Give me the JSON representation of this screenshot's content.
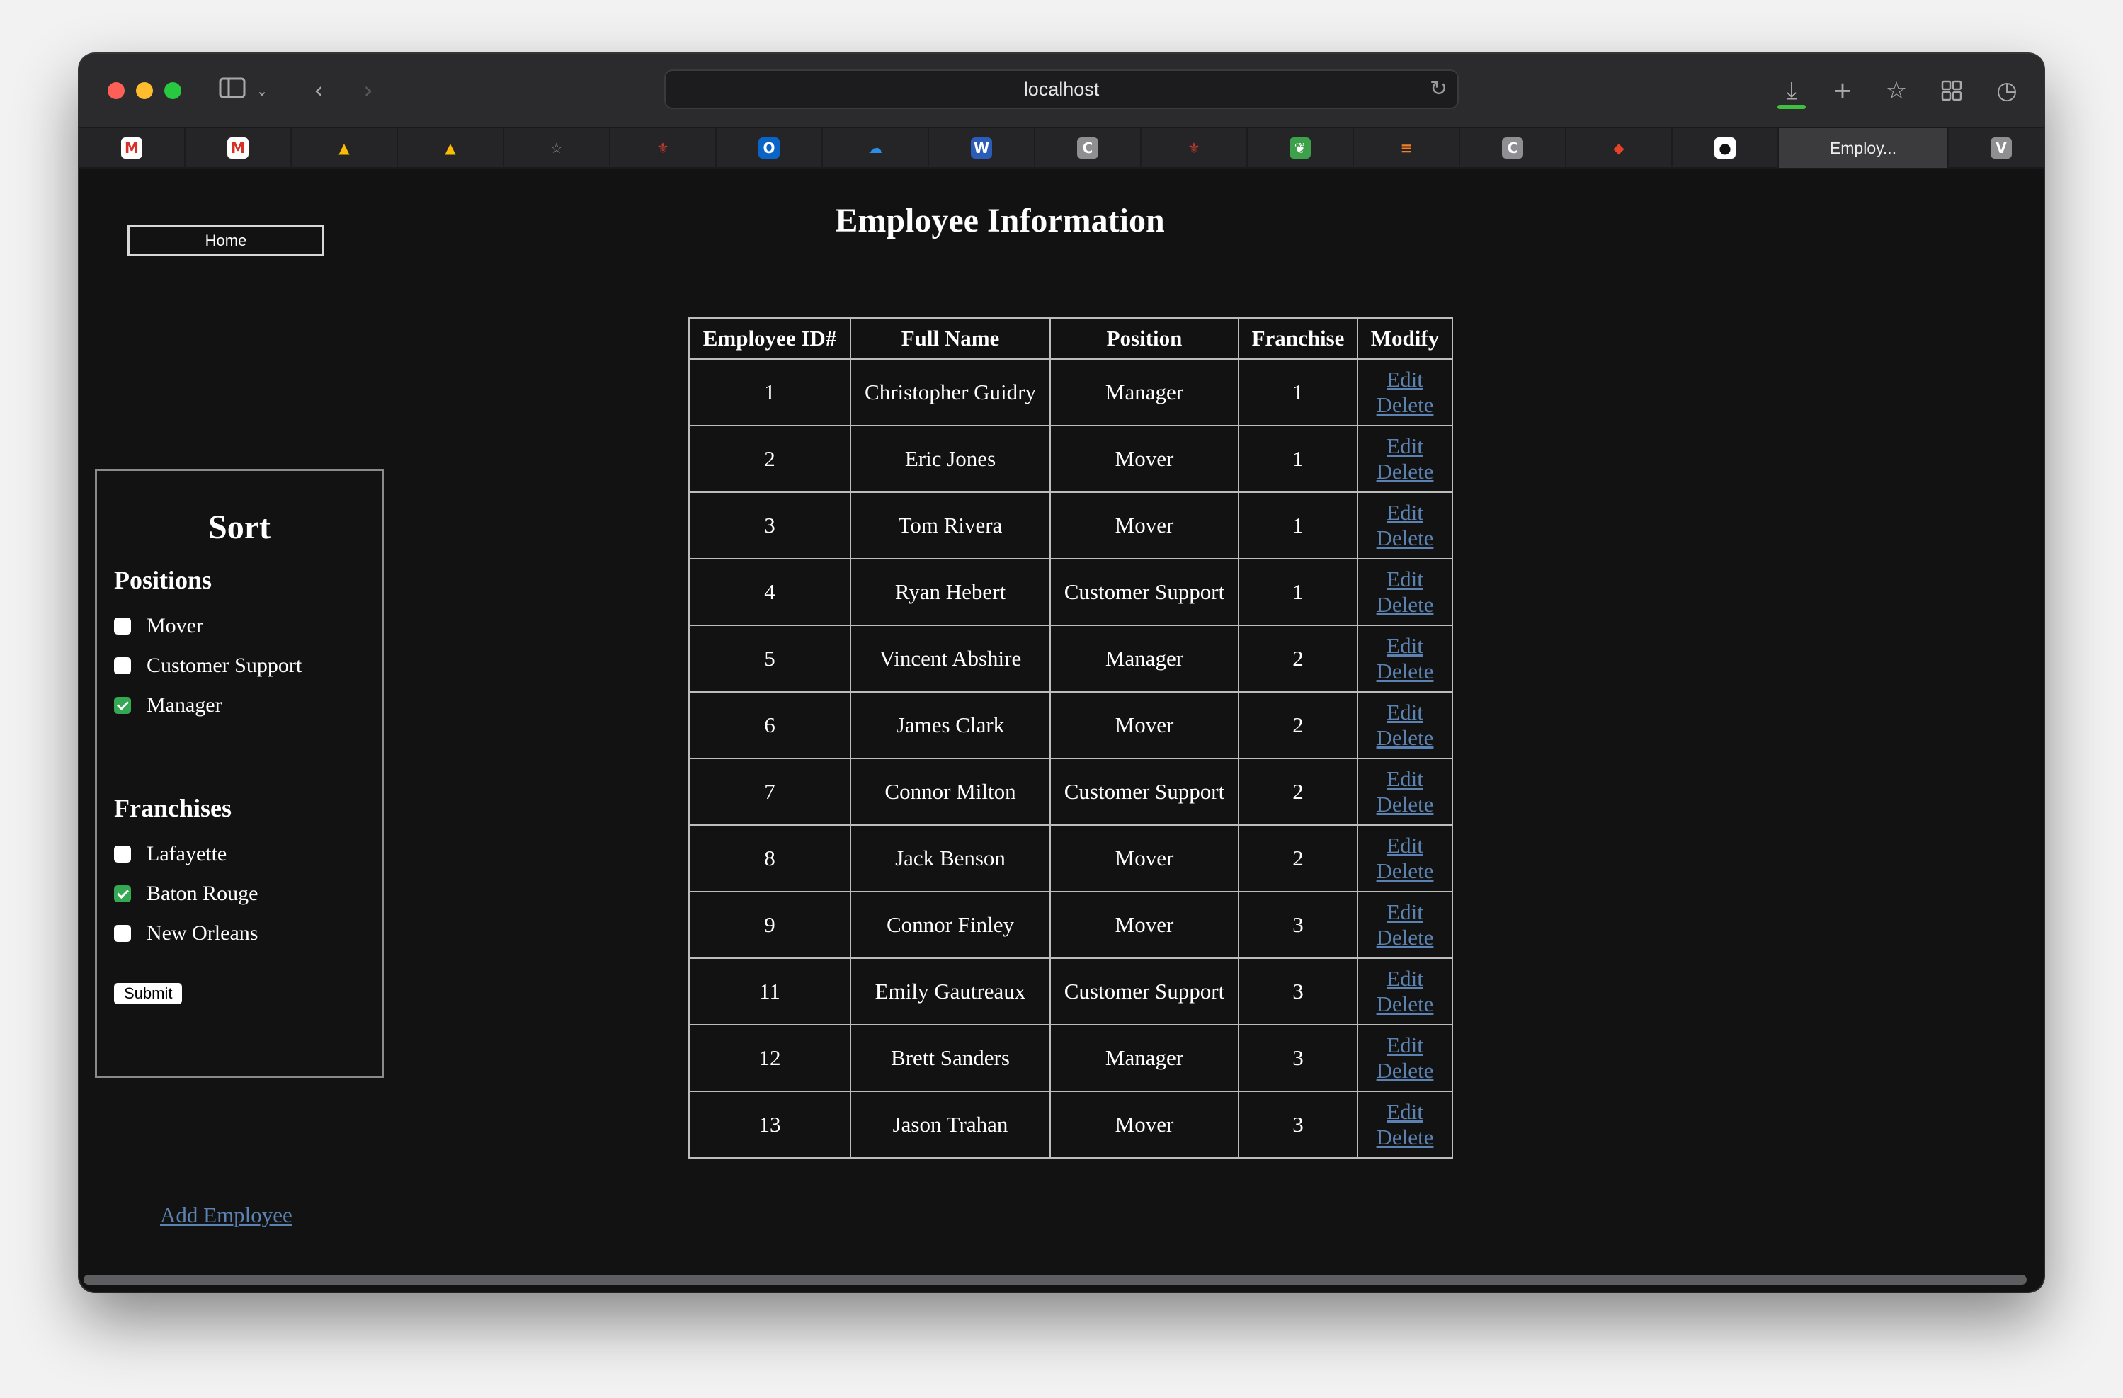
{
  "browser": {
    "url": "localhost",
    "tabs": [
      {
        "icon": "gmail-icon",
        "glyph": "M",
        "bg": "#ffffff",
        "fg": "#d93025"
      },
      {
        "icon": "gmail-icon",
        "glyph": "M",
        "bg": "#ffffff",
        "fg": "#d93025"
      },
      {
        "icon": "google-drive-icon",
        "glyph": "▲",
        "bg": "transparent",
        "fg": "#fbbc04"
      },
      {
        "icon": "google-drive-icon",
        "glyph": "▲",
        "bg": "transparent",
        "fg": "#fbbc04"
      },
      {
        "icon": "star-icon",
        "glyph": "☆",
        "bg": "transparent",
        "fg": "#a0a0a0"
      },
      {
        "icon": "fleur-de-lis-icon",
        "glyph": "⚜",
        "bg": "transparent",
        "fg": "#c0392b"
      },
      {
        "icon": "outlook-icon",
        "glyph": "O",
        "bg": "#0a64c8",
        "fg": "#ffffff"
      },
      {
        "icon": "onedrive-icon",
        "glyph": "☁",
        "bg": "transparent",
        "fg": "#2a8ee5"
      },
      {
        "icon": "word-icon",
        "glyph": "W",
        "bg": "#2b5cb8",
        "fg": "#ffffff"
      },
      {
        "icon": "c-letter-icon",
        "glyph": "C",
        "bg": "#8e8e93",
        "fg": "#ffffff"
      },
      {
        "icon": "fleur-de-lis-icon",
        "glyph": "⚜",
        "bg": "transparent",
        "fg": "#c0392b"
      },
      {
        "icon": "overleaf-icon",
        "glyph": "❦",
        "bg": "#3da04a",
        "fg": "#ffffff"
      },
      {
        "icon": "stackoverflow-icon",
        "glyph": "≡",
        "bg": "transparent",
        "fg": "#f48024"
      },
      {
        "icon": "c-letter-icon",
        "glyph": "C",
        "bg": "#8e8e93",
        "fg": "#ffffff"
      },
      {
        "icon": "gitlab-icon",
        "glyph": "◆",
        "bg": "transparent",
        "fg": "#e24329"
      },
      {
        "icon": "github-icon",
        "glyph": "●",
        "bg": "#ffffff",
        "fg": "#111111"
      },
      {
        "icon": "page-icon",
        "label": "Employ...",
        "active": true
      },
      {
        "icon": "v-letter-icon",
        "glyph": "V",
        "bg": "#8e8e93",
        "fg": "#ffffff"
      }
    ]
  },
  "nav": {
    "home_label": "Home"
  },
  "sort": {
    "title": "Sort",
    "positions_heading": "Positions",
    "positions": [
      {
        "label": "Mover",
        "checked": false
      },
      {
        "label": "Customer Support",
        "checked": false
      },
      {
        "label": "Manager",
        "checked": true
      }
    ],
    "franchises_heading": "Franchises",
    "franchises": [
      {
        "label": "Lafayette",
        "checked": false
      },
      {
        "label": "Baton Rouge",
        "checked": true
      },
      {
        "label": "New Orleans",
        "checked": false
      }
    ],
    "submit_label": "Submit"
  },
  "main": {
    "title": "Employee Information",
    "columns": [
      "Employee ID#",
      "Full Name",
      "Position",
      "Franchise",
      "Modify"
    ],
    "edit_label": "Edit",
    "delete_label": "Delete",
    "rows": [
      {
        "id": "1",
        "name": "Christopher Guidry",
        "position": "Manager",
        "franchise": "1"
      },
      {
        "id": "2",
        "name": "Eric Jones",
        "position": "Mover",
        "franchise": "1"
      },
      {
        "id": "3",
        "name": "Tom Rivera",
        "position": "Mover",
        "franchise": "1"
      },
      {
        "id": "4",
        "name": "Ryan Hebert",
        "position": "Customer Support",
        "franchise": "1"
      },
      {
        "id": "5",
        "name": "Vincent Abshire",
        "position": "Manager",
        "franchise": "2"
      },
      {
        "id": "6",
        "name": "James Clark",
        "position": "Mover",
        "franchise": "2"
      },
      {
        "id": "7",
        "name": "Connor Milton",
        "position": "Customer Support",
        "franchise": "2"
      },
      {
        "id": "8",
        "name": "Jack Benson",
        "position": "Mover",
        "franchise": "2"
      },
      {
        "id": "9",
        "name": "Connor Finley",
        "position": "Mover",
        "franchise": "3"
      },
      {
        "id": "11",
        "name": "Emily Gautreaux",
        "position": "Customer Support",
        "franchise": "3"
      },
      {
        "id": "12",
        "name": "Brett Sanders",
        "position": "Manager",
        "franchise": "3"
      },
      {
        "id": "13",
        "name": "Jason Trahan",
        "position": "Mover",
        "franchise": "3"
      }
    ],
    "add_employee_label": "Add Employee"
  }
}
